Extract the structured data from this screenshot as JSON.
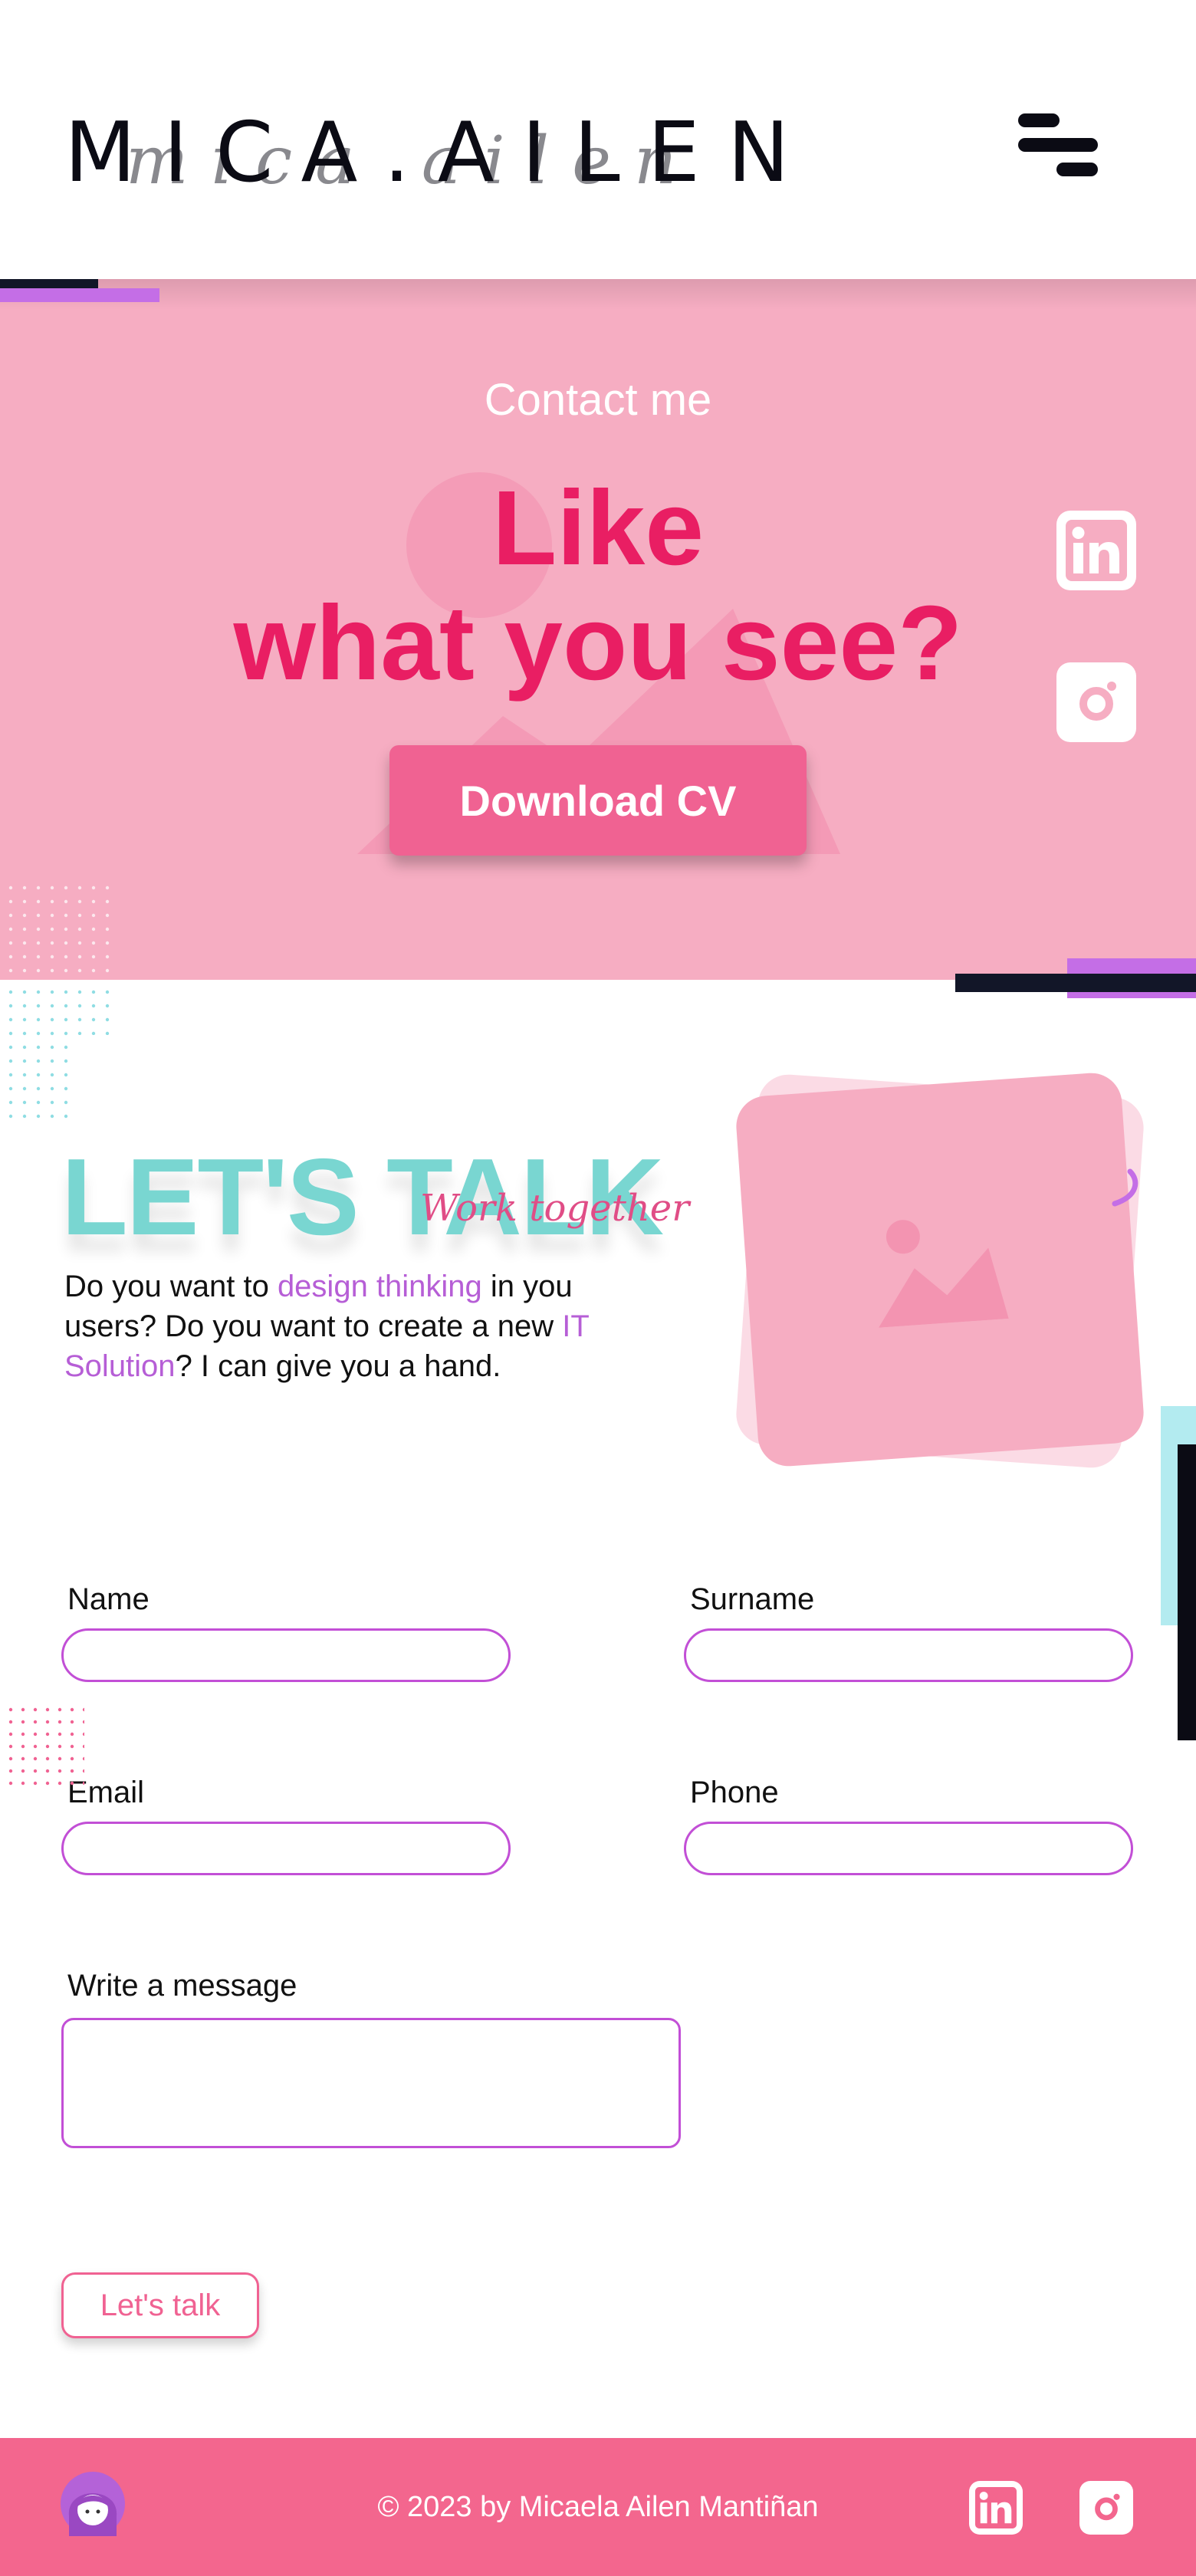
{
  "header": {
    "logo_text": "MICA.AILEN",
    "logo_script": "mica ailen",
    "menu_icon": "hamburger-menu-icon"
  },
  "hero": {
    "eyebrow": "Contact me",
    "title_line1": "Like",
    "title_line2": "what you see?",
    "cta_label": "Download CV",
    "social": [
      "linkedin-icon",
      "instagram-icon"
    ]
  },
  "talk": {
    "title": "LET'S TALK",
    "script": "Work together",
    "text_1": "Do you want to ",
    "text_hl1": "design thinking",
    "text_2": " in you users? Do you want to create a new ",
    "text_hl2": "IT Solution",
    "text_3": "? I can give you a hand.",
    "image_icon": "image-placeholder-icon"
  },
  "form": {
    "name_label": "Name",
    "surname_label": "Surname",
    "email_label": "Email",
    "phone_label": "Phone",
    "message_label": "Write a message",
    "name_value": "",
    "surname_value": "",
    "email_value": "",
    "phone_value": "",
    "message_value": "",
    "submit_label": "Let's talk"
  },
  "footer": {
    "copyright": "© 2023 by Micaela Ailen Mantiñan",
    "avatar_icon": "avatar-icon",
    "social": [
      "linkedin-icon",
      "instagram-icon"
    ]
  },
  "colors": {
    "hero_bg": "#f6adc2",
    "accent_pink": "#e91e63",
    "button_pink": "#f06292",
    "teal": "#79d6d1",
    "purple": "#c46ee6",
    "footer_bg": "#f3668e"
  }
}
